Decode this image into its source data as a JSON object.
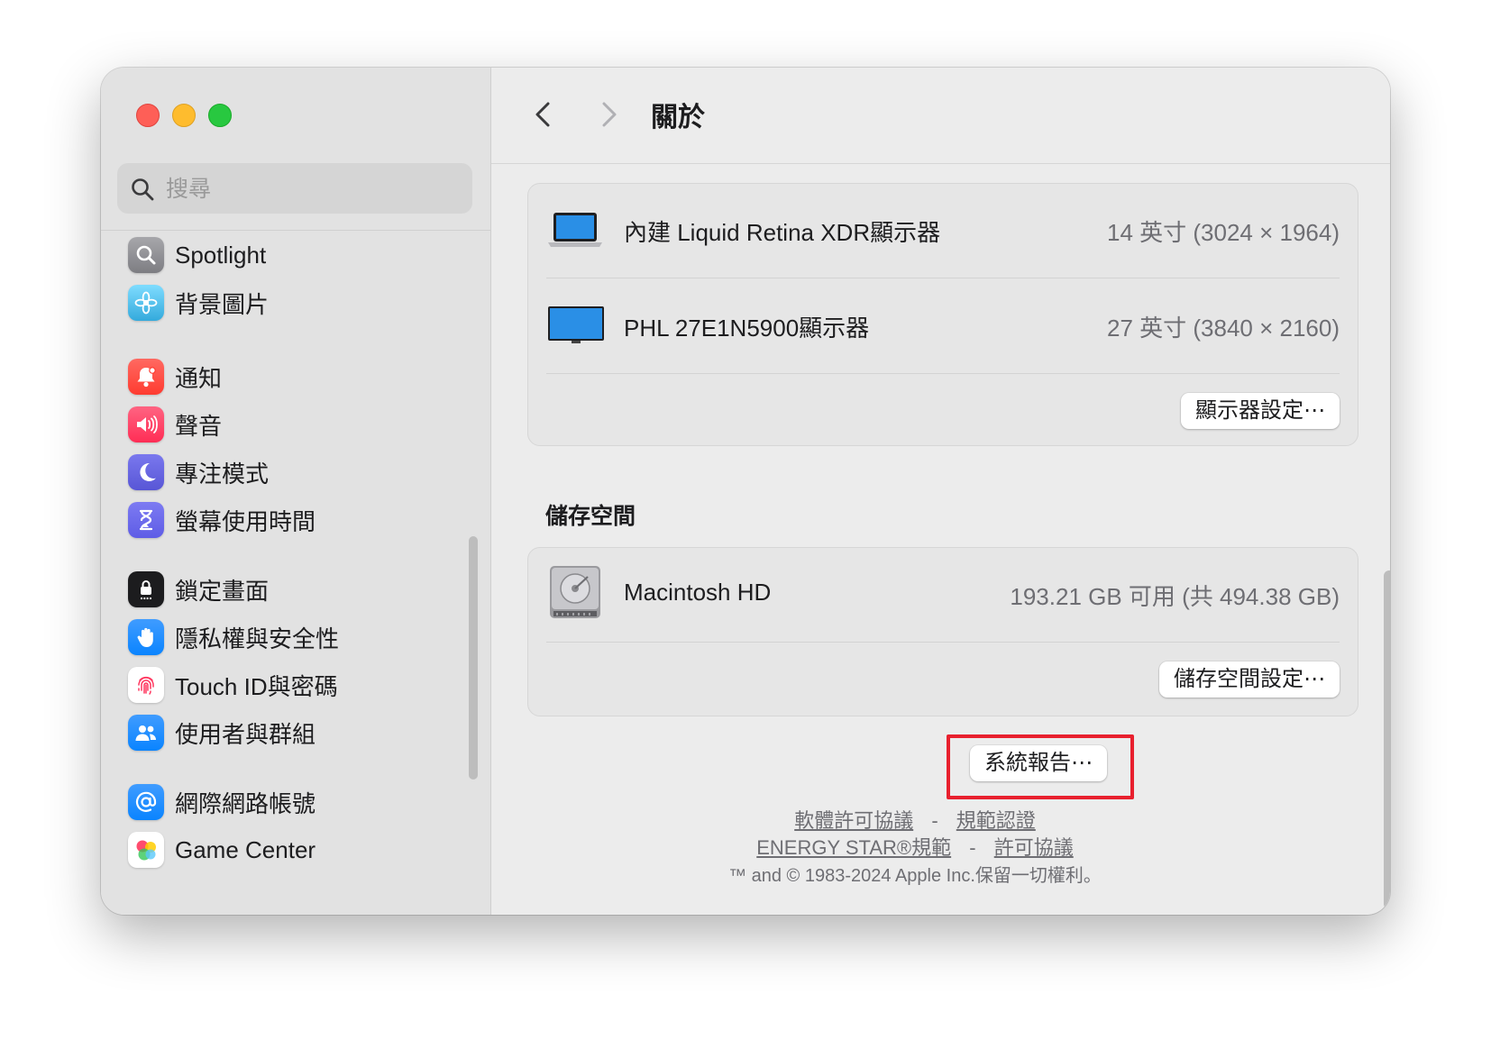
{
  "window": {
    "traffic_lights": [
      "close",
      "minimize",
      "zoom"
    ]
  },
  "sidebar": {
    "search": {
      "placeholder": "搜尋",
      "value": ""
    },
    "items": [
      {
        "label": "Spotlight",
        "icon": "spotlight-icon",
        "color": "#8e8e93"
      },
      {
        "label": "背景圖片",
        "icon": "wallpaper-icon",
        "color": "#5ac8fa"
      },
      {
        "label": "通知",
        "icon": "notifications-icon",
        "color": "#ff3b30"
      },
      {
        "label": "聲音",
        "icon": "sound-icon",
        "color": "#ff2d55"
      },
      {
        "label": "專注模式",
        "icon": "focus-icon",
        "color": "#5856d6"
      },
      {
        "label": "螢幕使用時間",
        "icon": "screen-time-icon",
        "color": "#5e5ce6"
      },
      {
        "label": "鎖定畫面",
        "icon": "lock-screen-icon",
        "color": "#1c1c1e"
      },
      {
        "label": "隱私權與安全性",
        "icon": "privacy-hand-icon",
        "color": "#0a84ff"
      },
      {
        "label": "Touch ID與密碼",
        "icon": "fingerprint-icon",
        "color": "#ffffff"
      },
      {
        "label": "使用者與群組",
        "icon": "users-icon",
        "color": "#0a84ff"
      },
      {
        "label": "網際網路帳號",
        "icon": "at-sign-icon",
        "color": "#0a84ff"
      },
      {
        "label": "Game Center",
        "icon": "game-center-icon",
        "color": "#ffffff"
      }
    ]
  },
  "toolbar": {
    "title": "關於"
  },
  "displays": {
    "rows": [
      {
        "name": "內建 Liquid Retina XDR顯示器",
        "value": "14 英寸 (3024 × 1964)",
        "icon": "laptop-icon"
      },
      {
        "name": "PHL 27E1N5900顯示器",
        "value": "27 英寸 (3840 × 2160)",
        "icon": "monitor-icon"
      }
    ],
    "settings_button": "顯示器設定⋯"
  },
  "storage": {
    "section_title": "儲存空間",
    "disk_name": "Macintosh HD",
    "disk_value": "193.21 GB 可用 (共 494.38 GB)",
    "settings_button": "儲存空間設定⋯"
  },
  "system_report_button": "系統報告⋯",
  "footer": {
    "software_license": "軟體許可協議",
    "regulatory": "規範認證",
    "energy_star": "ENERGY STAR®規範",
    "license": "許可協議",
    "dash": "-",
    "copyright": "™ and © 1983-2024 Apple Inc.保留一切權利。"
  },
  "colors": {
    "highlight_border": "#e8202e",
    "accent_blue": "#0a84ff"
  }
}
